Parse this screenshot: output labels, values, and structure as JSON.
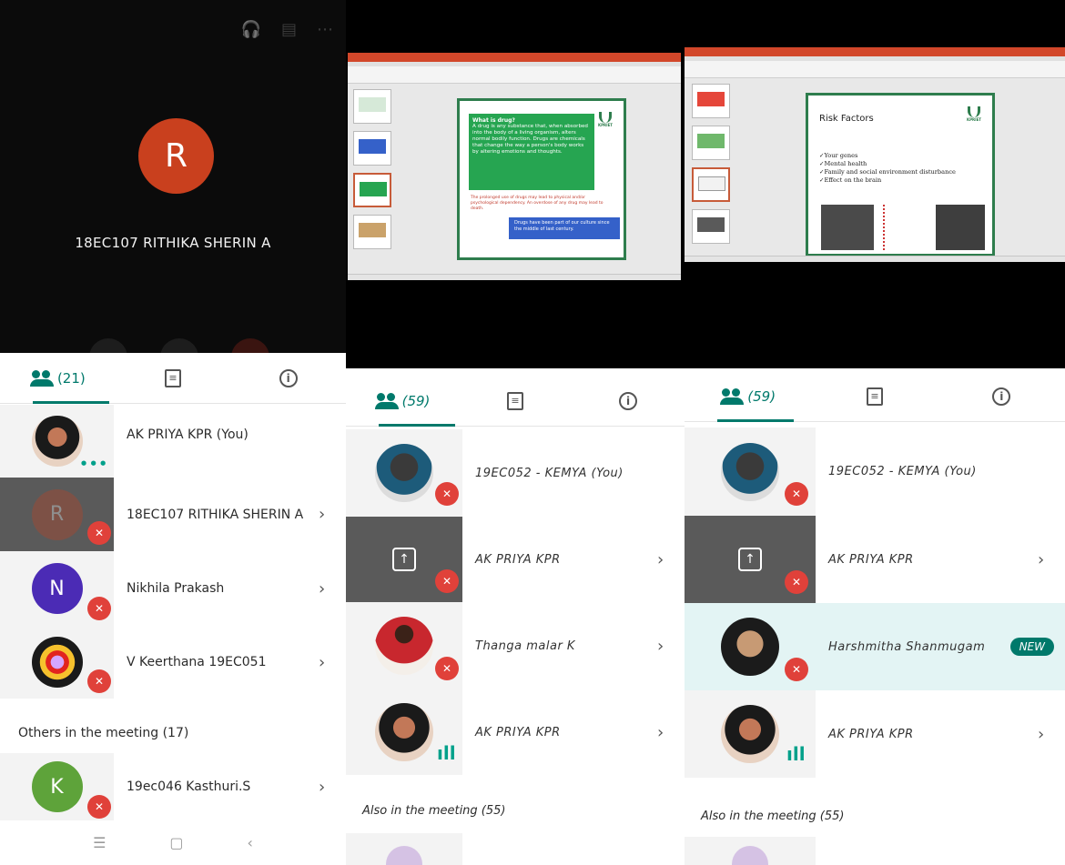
{
  "panel1": {
    "presenter": {
      "initial": "R",
      "name": "18EC107 RITHIKA SHERIN A"
    },
    "tabs": {
      "people_count": "(21)"
    },
    "participants": [
      {
        "name": "AK PRIYA KPR (You)",
        "initial": ""
      },
      {
        "name": "18EC107 RITHIKA SHERIN A",
        "initial": "R"
      },
      {
        "name": "Nikhila Prakash",
        "initial": "N"
      },
      {
        "name": "V Keerthana 19EC051",
        "initial": ""
      }
    ],
    "others_label": "Others in the meeting (17)",
    "others": [
      {
        "name": "19ec046 Kasthuri.S",
        "initial": "K"
      }
    ],
    "colors": {
      "presenter_avatar": "#c9401e",
      "nikhila": "#4b2bb5",
      "kasthuri": "#5ea33a"
    }
  },
  "panel2": {
    "slide": {
      "box_title": "What is drug?",
      "box_text": "A drug is any substance that, when absorbed into the body of a living organism, alters normal bodily function. Drugs are chemicals that change the way a person's body works by altering emotions and thoughts.",
      "red_text": "The prolonged use of drugs may lead to physical and/or psychological dependency. An overdose of any drug may lead to death.",
      "blue_text": "Drugs have been part of our culture since the middle of last century.",
      "logo": "KPRIET"
    },
    "tabs": {
      "people_count": "(59)"
    },
    "participants": [
      {
        "name": "19EC052 - KEMYA (You)"
      },
      {
        "name": "AK PRIYA KPR"
      },
      {
        "name": "Thanga malar K"
      },
      {
        "name": "AK PRIYA KPR"
      }
    ],
    "others_label": "Also in the meeting (55)"
  },
  "panel3": {
    "slide": {
      "title": "Risk Factors",
      "items": [
        "✓Your genes",
        "✓Mental health",
        "✓Family and social environment disturbance",
        "✓Effect on the brain"
      ],
      "logo": "KPRIET"
    },
    "tabs": {
      "people_count": "(59)"
    },
    "participants": [
      {
        "name": "19EC052 - KEMYA (You)"
      },
      {
        "name": "AK PRIYA KPR"
      },
      {
        "name": "Harshmitha Shanmugam",
        "badge": "NEW"
      },
      {
        "name": "AK PRIYA KPR"
      }
    ],
    "others_label": "Also in the meeting (55)"
  }
}
